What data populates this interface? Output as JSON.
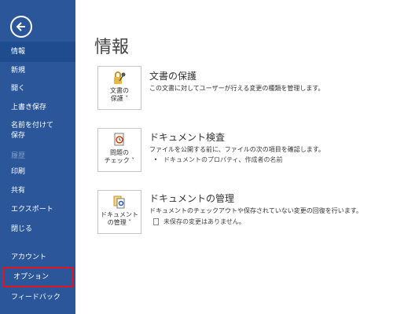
{
  "sidebar": {
    "items": [
      {
        "label": "情報"
      },
      {
        "label": "新規"
      },
      {
        "label": "開く"
      },
      {
        "label": "上書き保存"
      },
      {
        "label": "名前を付けて保存"
      },
      {
        "label": "履歴"
      },
      {
        "label": "印刷"
      },
      {
        "label": "共有"
      },
      {
        "label": "エクスポート"
      },
      {
        "label": "閉じる"
      },
      {
        "label": "アカウント"
      },
      {
        "label": "オプション"
      },
      {
        "label": "フィードバック"
      }
    ]
  },
  "main": {
    "title": "情報",
    "sections": [
      {
        "button_label": "文書の\n保護 ˅",
        "title": "文書の保護",
        "description": "この文書に対してユーザーが行える変更の種類を管理します。",
        "icon": "lock-key-icon"
      },
      {
        "button_label": "問題の\nチェック ˅",
        "title": "ドキュメント検査",
        "description": "ファイルを公開する前に、ファイルの次の項目を確認します。",
        "sub": "ドキュメントのプロパティ、作成者の名前",
        "icon": "inspect-document-icon"
      },
      {
        "button_label": "ドキュメント\nの管理 ˅",
        "title": "ドキュメントの管理",
        "description": "ドキュメントのチェックアウトや保存されていない変更の回復を行います。",
        "sub": "未保存の変更はありません。",
        "icon": "manage-document-icon"
      }
    ]
  },
  "colors": {
    "sidebar_bg": "#2b579a",
    "highlight": "#e0161c"
  }
}
